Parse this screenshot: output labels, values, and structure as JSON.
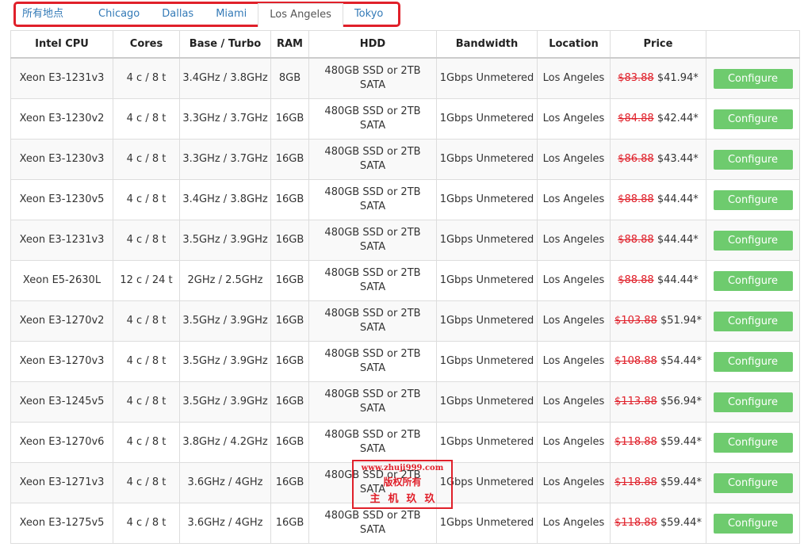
{
  "tabs": [
    {
      "label": "所有地点",
      "active": false
    },
    {
      "label": "Chicago",
      "active": false
    },
    {
      "label": "Dallas",
      "active": false
    },
    {
      "label": "Miami",
      "active": false
    },
    {
      "label": "Los Angeles",
      "active": true
    },
    {
      "label": "Tokyo",
      "active": false
    }
  ],
  "table": {
    "headers": [
      "Intel CPU",
      "Cores",
      "Base / Turbo",
      "RAM",
      "HDD",
      "Bandwidth",
      "Location",
      "Price",
      ""
    ],
    "rows": [
      {
        "cpu": "Xeon E3-1231v3",
        "cores": "4 c / 8 t",
        "freq": "3.4GHz / 3.8GHz",
        "ram": "8GB",
        "hdd": "480GB SSD or 2TB SATA",
        "bw": "1Gbps Unmetered",
        "loc": "Los Angeles",
        "old": "$83.88",
        "price": "$41.94*",
        "btn": "Configure"
      },
      {
        "cpu": "Xeon E3-1230v2",
        "cores": "4 c / 8 t",
        "freq": "3.3GHz / 3.7GHz",
        "ram": "16GB",
        "hdd": "480GB SSD or 2TB SATA",
        "bw": "1Gbps Unmetered",
        "loc": "Los Angeles",
        "old": "$84.88",
        "price": "$42.44*",
        "btn": "Configure"
      },
      {
        "cpu": "Xeon E3-1230v3",
        "cores": "4 c / 8 t",
        "freq": "3.3GHz / 3.7GHz",
        "ram": "16GB",
        "hdd": "480GB SSD or 2TB SATA",
        "bw": "1Gbps Unmetered",
        "loc": "Los Angeles",
        "old": "$86.88",
        "price": "$43.44*",
        "btn": "Configure"
      },
      {
        "cpu": "Xeon E3-1230v5",
        "cores": "4 c / 8 t",
        "freq": "3.4GHz / 3.8GHz",
        "ram": "16GB",
        "hdd": "480GB SSD or 2TB SATA",
        "bw": "1Gbps Unmetered",
        "loc": "Los Angeles",
        "old": "$88.88",
        "price": "$44.44*",
        "btn": "Configure"
      },
      {
        "cpu": "Xeon E3-1231v3",
        "cores": "4 c / 8 t",
        "freq": "3.5GHz / 3.9GHz",
        "ram": "16GB",
        "hdd": "480GB SSD or 2TB SATA",
        "bw": "1Gbps Unmetered",
        "loc": "Los Angeles",
        "old": "$88.88",
        "price": "$44.44*",
        "btn": "Configure"
      },
      {
        "cpu": "Xeon E5-2630L",
        "cores": "12 c / 24 t",
        "freq": "2GHz / 2.5GHz",
        "ram": "16GB",
        "hdd": "480GB SSD or 2TB SATA",
        "bw": "1Gbps Unmetered",
        "loc": "Los Angeles",
        "old": "$88.88",
        "price": "$44.44*",
        "btn": "Configure"
      },
      {
        "cpu": "Xeon E3-1270v2",
        "cores": "4 c / 8 t",
        "freq": "3.5GHz / 3.9GHz",
        "ram": "16GB",
        "hdd": "480GB SSD or 2TB SATA",
        "bw": "1Gbps Unmetered",
        "loc": "Los Angeles",
        "old": "$103.88",
        "price": "$51.94*",
        "btn": "Configure"
      },
      {
        "cpu": "Xeon E3-1270v3",
        "cores": "4 c / 8 t",
        "freq": "3.5GHz / 3.9GHz",
        "ram": "16GB",
        "hdd": "480GB SSD or 2TB SATA",
        "bw": "1Gbps Unmetered",
        "loc": "Los Angeles",
        "old": "$108.88",
        "price": "$54.44*",
        "btn": "Configure"
      },
      {
        "cpu": "Xeon E3-1245v5",
        "cores": "4 c / 8 t",
        "freq": "3.5GHz / 3.9GHz",
        "ram": "16GB",
        "hdd": "480GB SSD or 2TB SATA",
        "bw": "1Gbps Unmetered",
        "loc": "Los Angeles",
        "old": "$113.88",
        "price": "$56.94*",
        "btn": "Configure"
      },
      {
        "cpu": "Xeon E3-1270v6",
        "cores": "4 c / 8 t",
        "freq": "3.8GHz / 4.2GHz",
        "ram": "16GB",
        "hdd": "480GB SSD or 2TB SATA",
        "bw": "1Gbps Unmetered",
        "loc": "Los Angeles",
        "old": "$118.88",
        "price": "$59.44*",
        "btn": "Configure"
      },
      {
        "cpu": "Xeon E3-1271v3",
        "cores": "4 c / 8 t",
        "freq": "3.6GHz / 4GHz",
        "ram": "16GB",
        "hdd": "480GB SSD or 2TB SATA",
        "bw": "1Gbps Unmetered",
        "loc": "Los Angeles",
        "old": "$118.88",
        "price": "$59.44*",
        "btn": "Configure"
      },
      {
        "cpu": "Xeon E3-1275v5",
        "cores": "4 c / 8 t",
        "freq": "3.6GHz / 4GHz",
        "ram": "16GB",
        "hdd": "480GB SSD or 2TB SATA",
        "bw": "1Gbps Unmetered",
        "loc": "Los Angeles",
        "old": "$118.88",
        "price": "$59.44*",
        "btn": "Configure"
      }
    ]
  },
  "watermark": {
    "line1": "www.zhuji999.com",
    "line2": "版权所有",
    "line3": "主机玖玖"
  },
  "colors": {
    "link": "#337ab7",
    "strike": "#e0202a",
    "button": "#6ecb6e",
    "frame": "#e0202a"
  }
}
